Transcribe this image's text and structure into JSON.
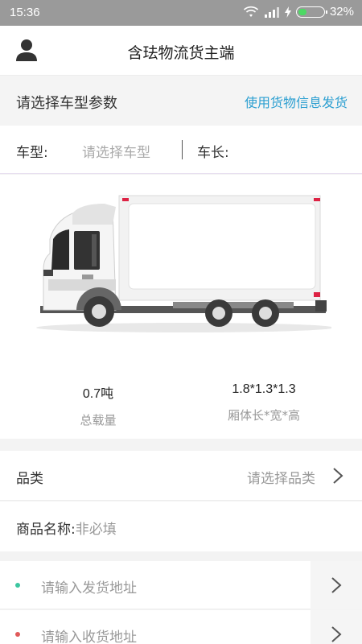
{
  "status_bar": {
    "time": "15:36",
    "battery": "32%",
    "battery_level": 0.32
  },
  "header": {
    "title": "含珐物流货主端",
    "avatar_icon": "user-icon"
  },
  "vehicle_section": {
    "heading": "请选择车型参数",
    "link": "使用货物信息发货"
  },
  "vehicle_type": {
    "type_label": "车型:",
    "type_placeholder": "请选择车型",
    "length_label": "车长:"
  },
  "specs": {
    "load_value": "0.7吨",
    "load_label": "总载量",
    "size_value": "1.8*1.3*1.3",
    "size_label": "厢体长*宽*高"
  },
  "category": {
    "label": "品类",
    "value": "请选择品类"
  },
  "product": {
    "label": "商品名称:",
    "placeholder": "非必填"
  },
  "addresses": {
    "from_placeholder": "请输入发货地址",
    "to_placeholder": "请输入收货地址",
    "from_color": "#3cc6a0",
    "to_color": "#e05a5a"
  }
}
